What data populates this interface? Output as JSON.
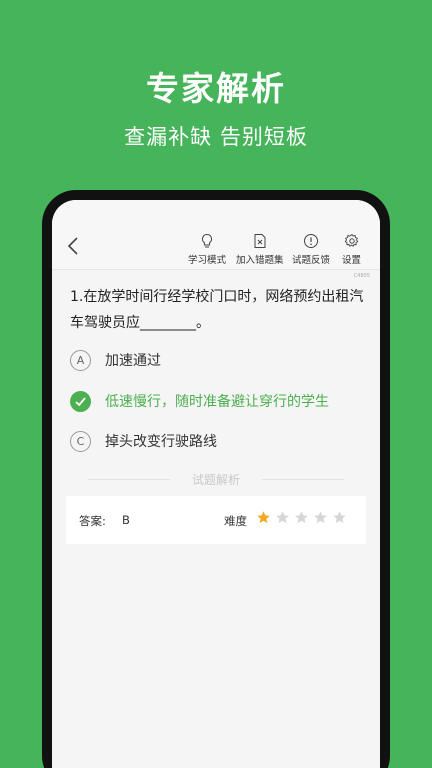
{
  "promo": {
    "title": "专家解析",
    "subtitle": "查漏补缺 告别短板"
  },
  "toolbar": {
    "items": [
      {
        "label": "学习模式",
        "icon": "lightbulb-icon"
      },
      {
        "label": "加入错题集",
        "icon": "file-x-icon"
      },
      {
        "label": "试题反馈",
        "icon": "exclamation-circle-icon"
      },
      {
        "label": "设置",
        "icon": "gear-icon"
      }
    ]
  },
  "question": {
    "id_tag": "C4805",
    "text": "1.在放学时间行经学校门口时，网络预约出租汽车驾驶员应________。",
    "options": [
      {
        "letter": "A",
        "text": "加速通过",
        "correct": false
      },
      {
        "letter": "B",
        "text": "低速慢行，随时准备避让穿行的学生",
        "correct": true
      },
      {
        "letter": "C",
        "text": "掉头改变行驶路线",
        "correct": false
      }
    ]
  },
  "analysis": {
    "section_label": "试题解析",
    "answer_label": "答案:",
    "answer_value": "B",
    "difficulty_label": "难度",
    "difficulty_rating": 1,
    "difficulty_max": 5
  },
  "colors": {
    "brand_green": "#46b45a",
    "correct_green": "#4caf50",
    "star_filled": "#f5a623",
    "star_empty": "#d6d6d6"
  }
}
